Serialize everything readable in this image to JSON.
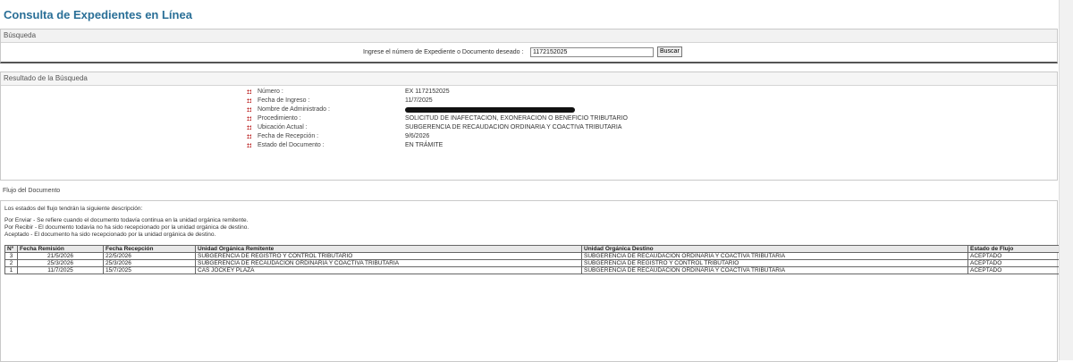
{
  "header": {
    "title": "Consulta de Expedientes en Línea"
  },
  "search": {
    "section_title": "Búsqueda",
    "label": "Ingrese el número de Expediente o Documento deseado :",
    "value": "1172152025",
    "button": "Buscar"
  },
  "result": {
    "section_title": "Resultado de la Búsqueda",
    "fields": [
      {
        "label": "Número :",
        "value": "EX 1172152025"
      },
      {
        "label": "Fecha de Ingreso :",
        "value": "11/7/2025"
      },
      {
        "label": "Nombre de Administrado :",
        "value": ""
      },
      {
        "label": "Procedimiento :",
        "value": "SOLICITUD DE INAFECTACION, EXONERACION O BENEFICIO TRIBUTARIO"
      },
      {
        "label": "Ubicación Actual :",
        "value": "SUBGERENCIA DE RECAUDACION ORDINARIA Y COACTIVA TRIBUTARIA"
      },
      {
        "label": "Fecha de Recepción :",
        "value": "9/6/2026"
      },
      {
        "label": "Estado del Documento :",
        "value": "EN TRÁMITE"
      }
    ]
  },
  "flow": {
    "section_title": "Flujo del Documento",
    "intro": "Los estados del flujo tendrán la siguiente descripción:",
    "descriptions": [
      "Por Enviar - Se refiere cuando el documento todavía continua en la unidad orgánica remitente.",
      "Por Recibir - El documento todavía no ha sido recepcionado por la unidad orgánica de destino.",
      "Aceptado - El documento ha sido recepcionado por la unidad orgánica de destino."
    ],
    "columns": [
      "Nº",
      "Fecha Remisión",
      "Fecha Recepción",
      "Unidad Orgánica Remitente",
      "Unidad Orgánica Destino",
      "Estado de Flujo"
    ],
    "rows": [
      [
        "3",
        "21/5/2026",
        "22/5/2026",
        "SUBGERENCIA DE REGISTRO Y CONTROL TRIBUTARIO",
        "SUBGERENCIA DE RECAUDACION ORDINARIA Y COACTIVA TRIBUTARIA",
        "ACEPTADO"
      ],
      [
        "2",
        "25/3/2026",
        "25/3/2026",
        "SUBGERENCIA DE RECAUDACION ORDINARIA Y COACTIVA TRIBUTARIA",
        "SUBGERENCIA DE REGISTRO Y CONTROL TRIBUTARIO",
        "ACEPTADO"
      ],
      [
        "1",
        "11/7/2025",
        "15/7/2025",
        "CAS JOCKEY PLAZA",
        "SUBGERENCIA DE RECAUDACION ORDINARIA Y COACTIVA TRIBUTARIA",
        "ACEPTADO"
      ]
    ]
  }
}
